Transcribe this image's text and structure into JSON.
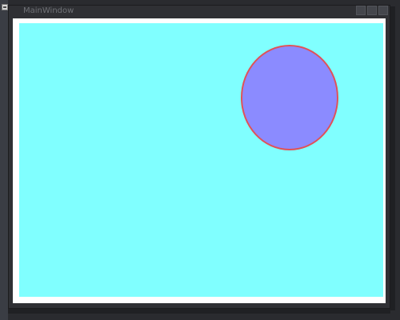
{
  "window": {
    "title": "MainWindow"
  },
  "icons": {
    "system_menu": "app-system-menu-icon",
    "minimize": "minimize-icon",
    "maximize": "maximize-icon",
    "close": "close-icon"
  },
  "colors": {
    "canvas_background": "#80ffff",
    "ellipse_fill": "#8b8bff",
    "ellipse_stroke": "#e05258"
  }
}
